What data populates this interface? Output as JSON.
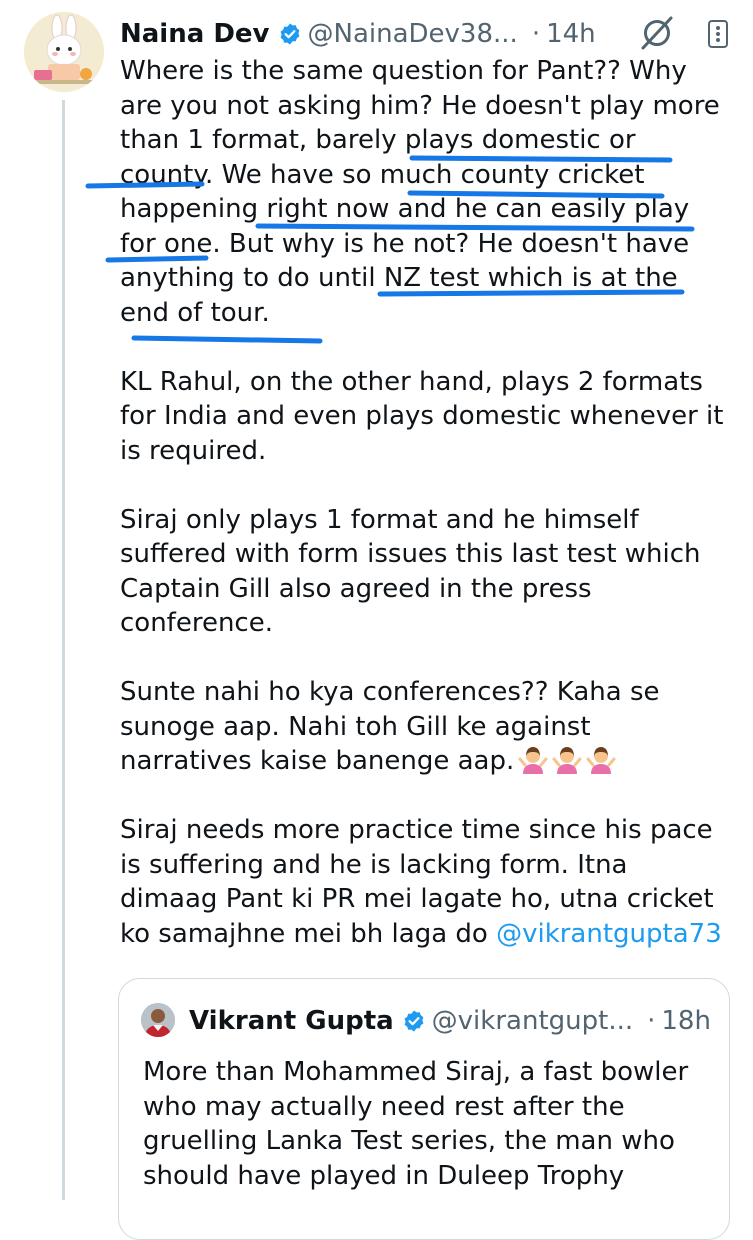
{
  "tweet": {
    "author_name": "Naina Dev",
    "handle": "@NainaDev38...",
    "separator": "·",
    "time": "14h",
    "paragraphs": [
      {
        "lines": [
          "Where is the same question for Pant?? Why",
          "are you not asking him? He doesn't play more",
          "than 1 format, barely plays domestic or",
          "county. We have so much county cricket",
          "happening right now and he can easily play",
          "for one. But why is he not? He doesn't have",
          "anything to do until NZ test which is at the",
          "end of tour."
        ]
      },
      {
        "lines": [
          "KL Rahul, on the other hand, plays 2 formats",
          "for India and even plays domestic whenever it",
          "is required."
        ]
      },
      {
        "lines": [
          "Siraj only plays 1 format and he himself",
          "suffered with form issues this last test which",
          "Captain Gill also agreed in the press",
          "conference."
        ]
      },
      {
        "lines": [
          "Sunte nahi ho kya conferences?? Kaha se",
          "sunoge aap. Nahi toh Gill ke against",
          "narratives kaise banenge aap."
        ]
      },
      {
        "lines": [
          "Siraj needs more practice time since his pace",
          "is suffering and he is lacking form. Itna",
          "dimaag Pant ki PR mei lagate ho, utna cricket",
          "ko samajhne mei bh laga do"
        ],
        "mention": "@vikrantgupta73"
      }
    ]
  },
  "quoted": {
    "author_name": "Vikrant Gupta",
    "handle": "@vikrantgupt...",
    "separator": "·",
    "time": "18h",
    "lines": [
      "More than Mohammed Siraj, a fast bowler",
      "who may actually need rest after the",
      "gruelling Lanka Test series, the man who",
      "should have played in Duleep Trophy"
    ]
  },
  "icons": {
    "verified": "verified-badge-icon",
    "grok": "grok-icon",
    "more": "more-options-icon",
    "emoji": "person-shrugging-emoji"
  },
  "colors": {
    "accent": "#1d9bf0",
    "secondary_text": "#536471",
    "annotation_ink": "#1677e6"
  }
}
